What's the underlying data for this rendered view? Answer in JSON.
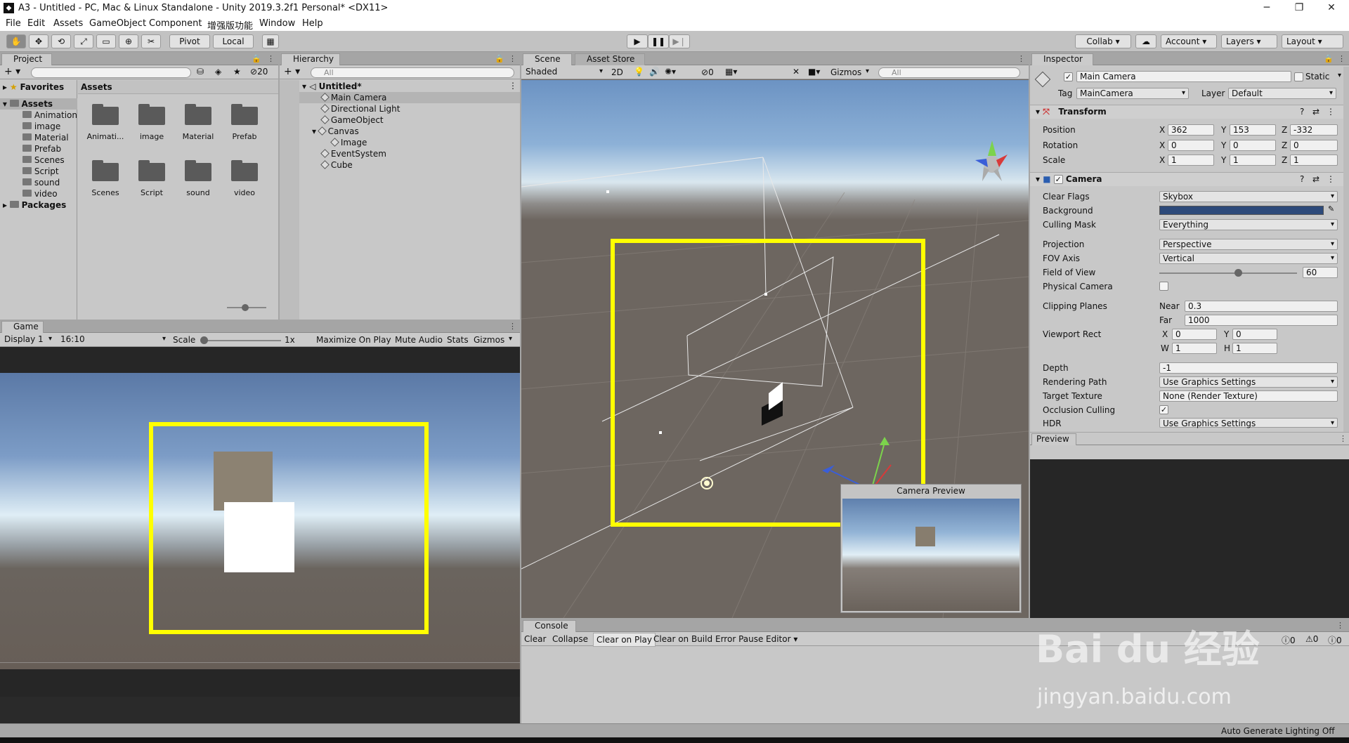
{
  "window": {
    "title": "A3 - Untitled - PC, Mac & Linux Standalone - Unity 2019.3.2f1 Personal* <DX11>"
  },
  "menu": [
    "File",
    "Edit",
    "Assets",
    "GameObject",
    "Component",
    "增强版功能",
    "Window",
    "Help"
  ],
  "toolbar": {
    "pivot": "Pivot",
    "local": "Local",
    "collab": "Collab",
    "account": "Account",
    "layers": "Layers",
    "layout": "Layout"
  },
  "project": {
    "tab": "Project",
    "hidden_count": "20",
    "assets_header": "Assets",
    "favorites": "Favorites",
    "assets": "Assets",
    "packages": "Packages",
    "tree": [
      "Animation",
      "image",
      "Material",
      "Prefab",
      "Scenes",
      "Script",
      "sound",
      "video"
    ],
    "grid": [
      "Animati...",
      "image",
      "Material",
      "Prefab",
      "Scenes",
      "Script",
      "sound",
      "video"
    ],
    "search_placeholder": ""
  },
  "hierarchy": {
    "tab": "Hierarchy",
    "search_placeholder": "All",
    "scene": "Untitled*",
    "items": [
      "Main Camera",
      "Directional Light",
      "GameObject",
      "Canvas",
      "Image",
      "EventSystem",
      "Cube"
    ]
  },
  "scene": {
    "tab": "Scene",
    "tab2": "Asset Store",
    "shading": "Shaded",
    "mode2d": "2D",
    "hidden": "0",
    "gizmos": "Gizmos",
    "search_placeholder": "All",
    "camera_preview": "Camera Preview"
  },
  "game": {
    "tab": "Game",
    "display": "Display 1",
    "aspect": "16:10",
    "scale_label": "Scale",
    "scale_value": "1x",
    "maximize": "Maximize On Play",
    "mute": "Mute Audio",
    "stats": "Stats",
    "gizmos": "Gizmos"
  },
  "inspector": {
    "tab": "Inspector",
    "name": "Main Camera",
    "static": "Static",
    "tag_label": "Tag",
    "tag": "MainCamera",
    "layer_label": "Layer",
    "layer": "Default",
    "transform": {
      "title": "Transform",
      "position_label": "Position",
      "rotation_label": "Rotation",
      "scale_label": "Scale",
      "position": [
        "362",
        "153",
        "-332"
      ],
      "rotation": [
        "0",
        "0",
        "0"
      ],
      "scale": [
        "1",
        "1",
        "1"
      ]
    },
    "camera": {
      "title": "Camera",
      "clear_flags_label": "Clear Flags",
      "clear_flags": "Skybox",
      "background_label": "Background",
      "background_color": "#2d4a7a",
      "culling_mask_label": "Culling Mask",
      "culling_mask": "Everything",
      "projection_label": "Projection",
      "projection": "Perspective",
      "fov_axis_label": "FOV Axis",
      "fov_axis": "Vertical",
      "fov_label": "Field of View",
      "fov": "60",
      "fov_fraction": 0.57,
      "physical_label": "Physical Camera",
      "clipping_label": "Clipping Planes",
      "near_label": "Near",
      "near": "0.3",
      "far_label": "Far",
      "far": "1000",
      "viewport_label": "Viewport Rect",
      "vx": "0",
      "vy": "0",
      "vw": "1",
      "vh": "1",
      "depth_label": "Depth",
      "depth": "-1",
      "rendering_path_label": "Rendering Path",
      "rendering_path": "Use Graphics Settings",
      "target_texture_label": "Target Texture",
      "target_texture": "None (Render Texture)",
      "occlusion_label": "Occlusion Culling",
      "hdr_label": "HDR",
      "hdr": "Use Graphics Settings"
    },
    "preview": "Preview"
  },
  "console": {
    "tab": "Console",
    "clear": "Clear",
    "collapse": "Collapse",
    "clear_on_play": "Clear on Play",
    "clear_on_build": "Clear on Build",
    "error_pause": "Error Pause",
    "editor": "Editor",
    "count_info": "0",
    "count_warn": "0",
    "count_err": "0"
  },
  "statusbar": {
    "text": "Auto Generate Lighting Off"
  },
  "watermark": {
    "brand": "Bai du 经验",
    "url": "jingyan.baidu.com"
  },
  "colors": {
    "highlight": "#ffff00"
  }
}
